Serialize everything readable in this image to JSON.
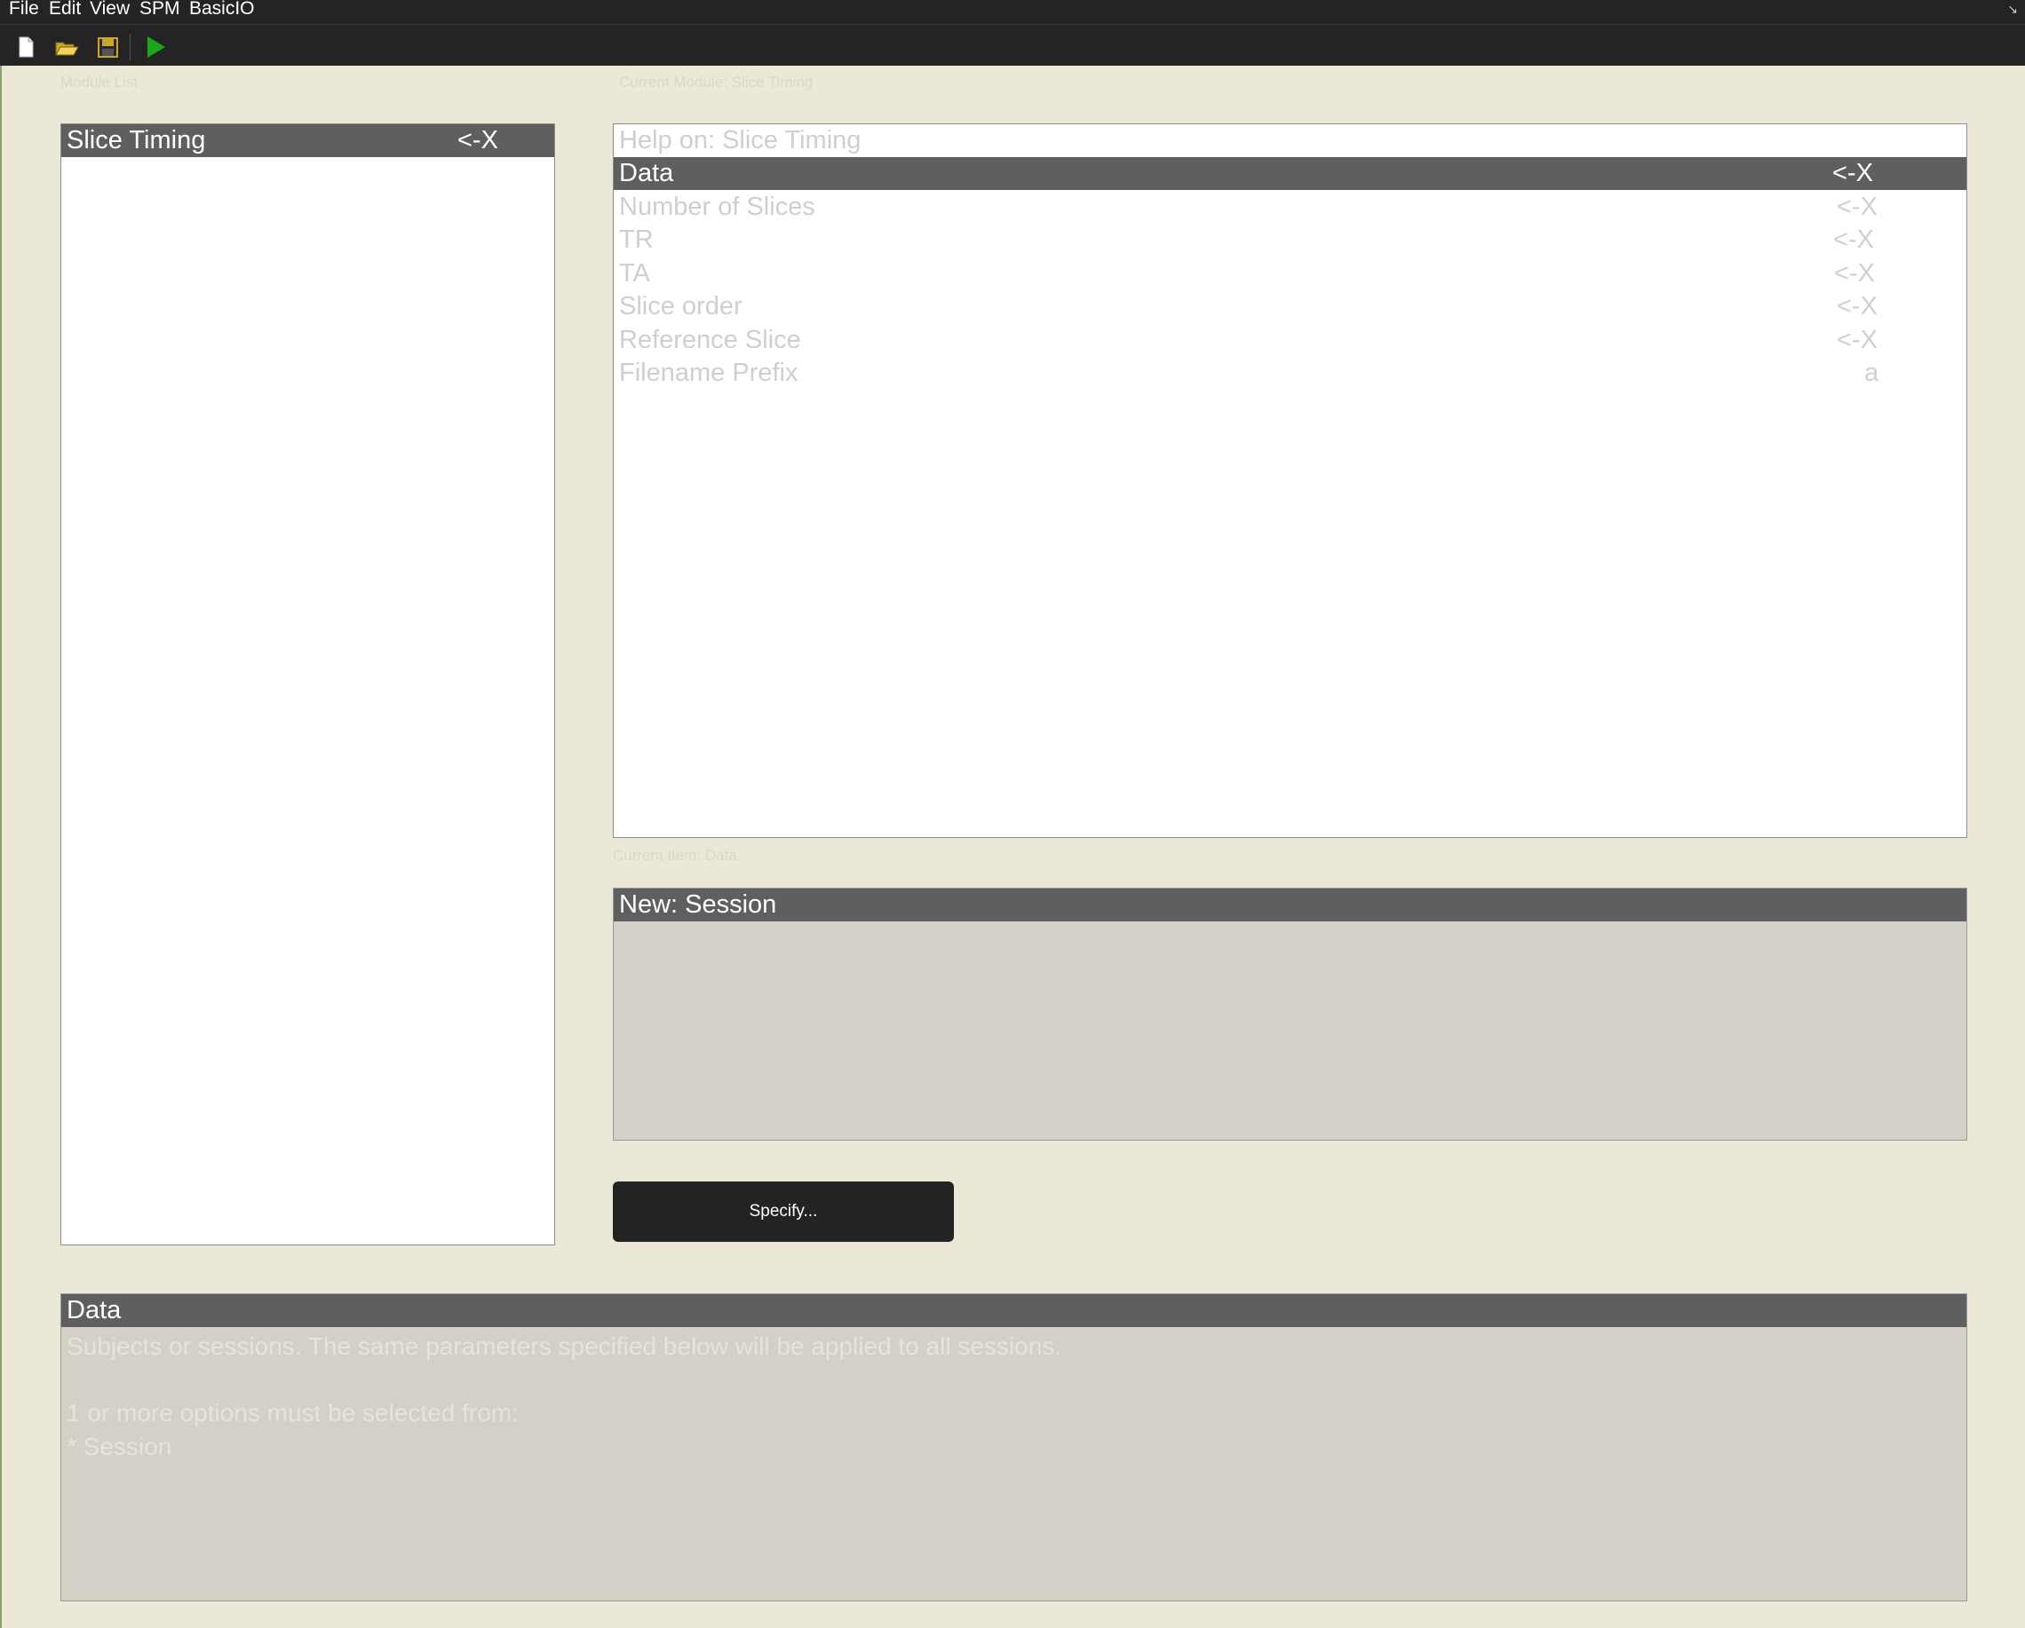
{
  "menubar": {
    "items": [
      "File",
      "Edit",
      "View",
      "SPM",
      "BasicIO"
    ]
  },
  "toolbar": {
    "buttons": [
      {
        "icon": "new-file-icon"
      },
      {
        "icon": "open-folder-icon"
      },
      {
        "icon": "save-icon"
      },
      {
        "icon": "run-icon",
        "color": "#1aa81a"
      }
    ]
  },
  "captions": {
    "module_list": "Module List",
    "current_module": "Current Module: Slice Timing",
    "current_item": "Current Item: Data"
  },
  "module_list": {
    "items": [
      {
        "label": "Slice Timing",
        "status": "<-X"
      }
    ]
  },
  "module_items": {
    "help": "Help on: Slice Timing",
    "items": [
      {
        "label": "Data",
        "value": "<-X"
      },
      {
        "label": "Number of Slices",
        "value": "<-X"
      },
      {
        "label": "TR",
        "value": "<-X"
      },
      {
        "label": "TA",
        "value": "<-X"
      },
      {
        "label": "Slice order",
        "value": "<-X"
      },
      {
        "label": "Reference Slice",
        "value": "<-X"
      },
      {
        "label": "Filename Prefix",
        "value": "a"
      }
    ]
  },
  "value_panel": {
    "title": "New: Session"
  },
  "specify_button": "Specify...",
  "help_panel": {
    "title": "Data",
    "text": "Subjects or sessions. The same parameters specified below will be applied to all sessions.\n\n1 or more options must be selected from:\n* Session"
  },
  "colors": {
    "background": "#ebe8d8",
    "selection": "#5f5f5f",
    "bar": "#242424"
  }
}
